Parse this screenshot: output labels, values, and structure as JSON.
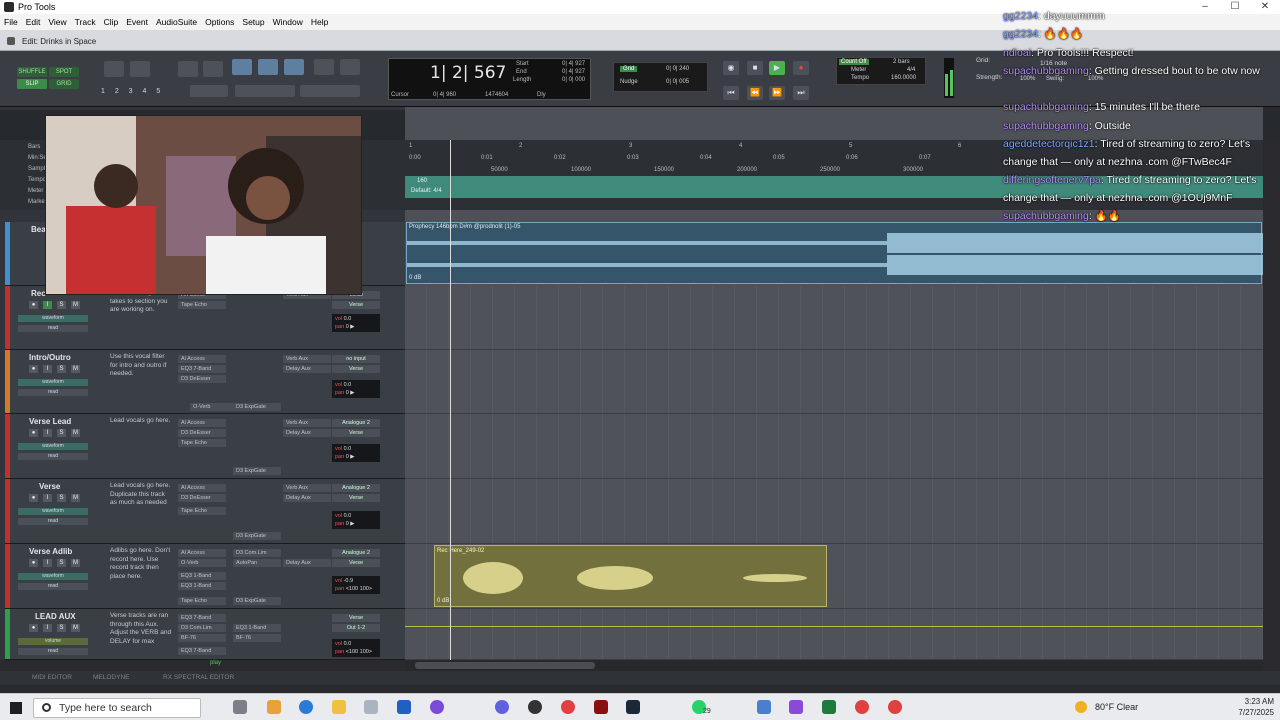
{
  "window": {
    "title": "Pro Tools",
    "edit_title": "Edit: Drinks in Space"
  },
  "menu": [
    "File",
    "Edit",
    "View",
    "Track",
    "Clip",
    "Event",
    "AudioSuite",
    "Options",
    "Setup",
    "Window",
    "Help"
  ],
  "toolbar": {
    "modes": [
      "SHUFFLE",
      "SPOT",
      "SLIP",
      "GRID"
    ],
    "zoom_presets": "1 2 3 4 5",
    "counter_main": "1| 2| 567",
    "counter_labels": {
      "start": "Start",
      "end": "End",
      "length": "Length",
      "cursor": "Cursor"
    },
    "counter_values": {
      "start": "0| 4| 927",
      "end": "0| 4| 927",
      "length": "0| 0| 000",
      "cursor_val": "0| 4| 960",
      "samples": "1474604",
      "dly": "Dly"
    },
    "grid_label": "Grid",
    "grid_value": "0| 0| 240",
    "nudge_label": "Nudge",
    "nudge_value": "0| 0| 005",
    "count_off": "Count Off",
    "bars": "2 bars",
    "meter": "Meter",
    "meter_value": "4/4",
    "tempo": "Tempo",
    "tempo_value": "160.0000",
    "grid_right": "Grid:",
    "grid_right_val": "1/16 note",
    "strength": "Strength:",
    "strength_val": "100%",
    "swing": "Swing:",
    "swing_val": "100%"
  },
  "rulers": {
    "labels": [
      "Bars",
      "Min:Secs",
      "Samples",
      "Tempo",
      "Meter",
      "Markers"
    ],
    "bars_ticks": [
      "1",
      "2",
      "3",
      "4",
      "5",
      "6"
    ],
    "min_ticks": [
      "0:00",
      "0:01",
      "0:02",
      "0:03",
      "0:04",
      "0:05",
      "0:06",
      "0:07"
    ],
    "sample_ticks": [
      "50000",
      "100000",
      "150000",
      "200000",
      "250000",
      "300000"
    ],
    "tempo_value": "160",
    "meter_value": "Default: 4/4"
  },
  "tracks": [
    {
      "name": "Beat",
      "color": "#3f8fd3",
      "clip": "Prophecy 146bpm D#m @prodnolit (1)-05",
      "db": "0 dB"
    },
    {
      "name": "Rec",
      "color": "#c2302e",
      "note": "track and drag the takes to section you are working on.",
      "inserts": [
        "Al Access",
        "Tape Echo"
      ],
      "sends": [
        "Verb Aux"
      ],
      "io": [
        "Verse",
        "Verse"
      ],
      "vol": "0.0",
      "pan": "0 ▶",
      "mode": "waveform",
      "auto": "read"
    },
    {
      "name": "Intro/Outro",
      "color": "#d07a2a",
      "note": "Use this vocal filter for intro and outro if needed.",
      "inserts": [
        "Al Access",
        "EQ3 7-Band",
        "D3 DeEsser",
        "O-Verb"
      ],
      "sends": [
        "Verb Aux",
        "Delay Aux"
      ],
      "io": [
        "no input",
        "Verse"
      ],
      "vol": "0.0",
      "pan": "0 ▶",
      "mode": "waveform",
      "auto": "read",
      "extra": "D3 ExpGate"
    },
    {
      "name": "Verse Lead",
      "color": "#c2302e",
      "note": "Lead vocals go here.",
      "inserts": [
        "Al Access",
        "D3 DeEsser",
        "Tape Echo"
      ],
      "sends": [
        "Verb Aux",
        "Delay Aux"
      ],
      "io": [
        "Analogue 2",
        "Verse"
      ],
      "vol": "0.0",
      "pan": "0 ▶",
      "mode": "waveform",
      "auto": "read",
      "extra": "D3 ExpGate"
    },
    {
      "name": "Verse",
      "color": "#c2302e",
      "note": "Lead vocals go here. Duplicate this track as much as needed",
      "inserts": [
        "Al Access",
        "D3 DeEsser",
        "Tape Echo"
      ],
      "sends": [
        "Verb Aux",
        "Delay Aux"
      ],
      "io": [
        "Analogue 2",
        "Verse"
      ],
      "vol": "0.0",
      "pan": "0 ▶",
      "mode": "waveform",
      "auto": "read",
      "extra": "D3 ExpGate"
    },
    {
      "name": "Verse Adlib",
      "color": "#c2302e",
      "note": "Adlibs go here. Don't record here. Use record track then place here.",
      "inserts": [
        "Al Access",
        "O-Verb",
        "EQ3 1-Band",
        "EQ3 1-Band",
        "Tape Echo"
      ],
      "sends": [
        "D3 Com.Lim",
        "AutoPan",
        "Delay Aux"
      ],
      "io": [
        "Analogue 2",
        "Verse"
      ],
      "vol": "-0.9",
      "pan": "<100 100>",
      "mode": "waveform",
      "auto": "read",
      "extra": "D3 ExpGate",
      "clip": "Rec Here_249-02",
      "db": "0 dB"
    },
    {
      "name": "LEAD AUX",
      "color": "#2fa04a",
      "note": "Verse tracks are ran through this Aux. Adjust the VERB and DELAY for max",
      "inserts": [
        "EQ3 7-Band",
        "D3 Com.Lim",
        "BF-76",
        "EQ3 7-Band"
      ],
      "sends": [
        "EQ3 1-Band",
        "BF-76"
      ],
      "io": [
        "Verse",
        "Out 1-2"
      ],
      "vol": "0.0",
      "pan": "<100 100>",
      "mode": "volume",
      "auto": "read"
    }
  ],
  "bottom_tabs": [
    "MIDI EDITOR",
    "MELODYNE",
    "RX SPECTRAL EDITOR"
  ],
  "bottom_play": "play",
  "chat": [
    {
      "user": "gg2234",
      "msg": ": dayuuummm",
      "color": "blue"
    },
    {
      "user": "gg2234",
      "msg": ": 🔥🔥🔥",
      "color": "blue"
    },
    {
      "user": "ndioai",
      "msg": ": Pro Tools!!! Respect!",
      "color": "purple"
    },
    {
      "user": "supachubbgaming",
      "msg": ": Getting dressed bout to be otw now",
      "color": "purple"
    },
    {
      "user": "supachubbgaming",
      "msg": ": 15 minutes I'll be there",
      "color": "purple"
    },
    {
      "user": "supachubbgaming",
      "msg": ": Outside",
      "color": "purple"
    },
    {
      "user": "ageddetectorqic1z1",
      "msg": ": Tired of streaming to zero? Let's change that — only at nezhna .com @FTwBec4F",
      "color": "blue"
    },
    {
      "user": "differingsoftenerv7pa",
      "msg": ": Tired of streaming to zero? Let's change that — only at nezhna .com @1OUj9MnF",
      "color": "purple"
    },
    {
      "user": "supachubbgaming",
      "msg": ": 🔥🔥",
      "color": "purple"
    }
  ],
  "taskbar": {
    "search_placeholder": "Type here to search",
    "weather": "80°F  Clear",
    "time": "3:23 AM",
    "date": "7/27/2025",
    "badge": "29"
  }
}
